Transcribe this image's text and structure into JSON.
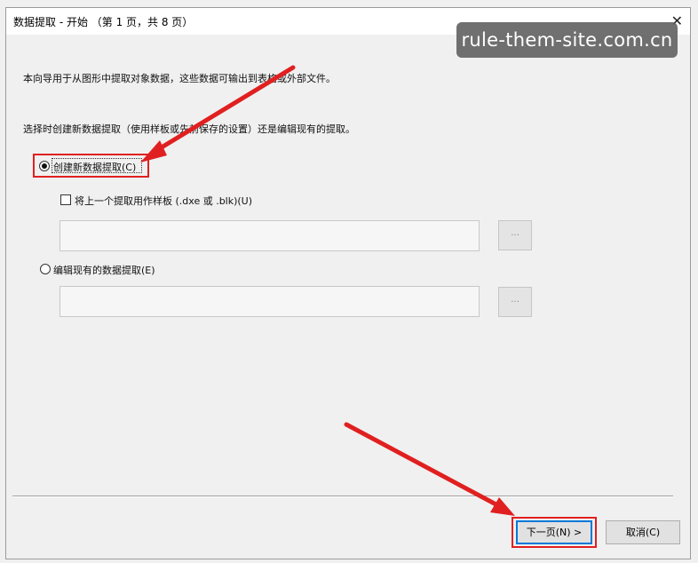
{
  "window": {
    "title": "数据提取 - 开始 （第 1 页，共 8 页）",
    "close_glyph": "✕"
  },
  "watermark": "rule-them-site.com.cn",
  "intro_text": "本向导用于从图形中提取对象数据，这些数据可输出到表格或外部文件。",
  "choice_prompt": "选择时创建新数据提取（使用样板或先前保存的设置）还是编辑现有的提取。",
  "options": {
    "create_new": {
      "label": "创建新数据提取(C)",
      "selected": true
    },
    "use_template": {
      "label": "将上一个提取用作样板 (.dxe 或 .blk)(U)",
      "checked": false
    },
    "template_path": {
      "value": ""
    },
    "template_browse_label": "...",
    "edit_existing": {
      "label": "编辑现有的数据提取(E)",
      "selected": false
    },
    "existing_path": {
      "value": ""
    },
    "existing_browse_label": "..."
  },
  "buttons": {
    "next": "下一页(N) >",
    "cancel": "取消(C)"
  },
  "colors": {
    "annotation_red": "#e02020",
    "primary_border": "#0078d7"
  }
}
